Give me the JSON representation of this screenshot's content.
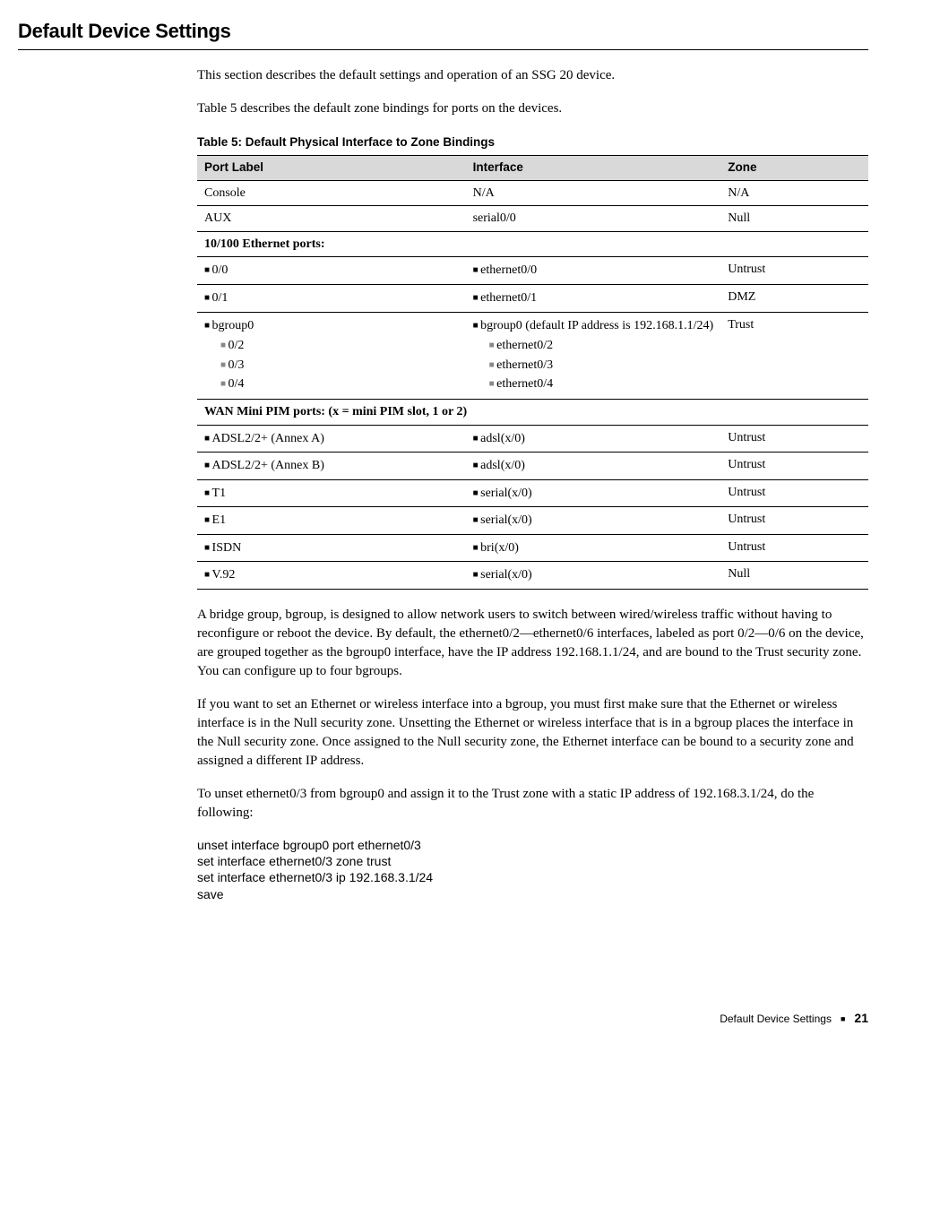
{
  "heading": "Default Device Settings",
  "intro": "This section describes the default settings and operation of an SSG 20 device.",
  "table_lead": "Table 5 describes the default zone bindings for ports on the devices.",
  "table_caption": "Table 5:  Default Physical Interface to Zone Bindings",
  "th": {
    "c1": "Port Label",
    "c2": "Interface",
    "c3": "Zone"
  },
  "rows": {
    "r0": {
      "c1": "Console",
      "c2": "N/A",
      "c3": "N/A"
    },
    "r1": {
      "c1": "AUX",
      "c2": "serial0/0",
      "c3": "Null"
    },
    "sub1": "10/100 Ethernet ports:",
    "r2": {
      "c1": "0/0",
      "c2": "ethernet0/0",
      "c3": "Untrust"
    },
    "r3": {
      "c1": "0/1",
      "c2": "ethernet0/1",
      "c3": "DMZ"
    },
    "r4": {
      "c1_main": "bgroup0",
      "c1_sub": [
        "0/2",
        "0/3",
        "0/4"
      ],
      "c2_main": "bgroup0 (default IP address is 192.168.1.1/24)",
      "c2_sub": [
        "ethernet0/2",
        "ethernet0/3",
        "ethernet0/4"
      ],
      "c3": "Trust"
    },
    "sub2": "WAN Mini PIM ports: (x = mini PIM slot, 1 or 2)",
    "r5": {
      "c1": "ADSL2/2+ (Annex A)",
      "c2": "adsl(x/0)",
      "c3": "Untrust"
    },
    "r6": {
      "c1": "ADSL2/2+ (Annex B)",
      "c2": "adsl(x/0)",
      "c3": "Untrust"
    },
    "r7": {
      "c1": "T1",
      "c2": "serial(x/0)",
      "c3": "Untrust"
    },
    "r8": {
      "c1": "E1",
      "c2": "serial(x/0)",
      "c3": "Untrust"
    },
    "r9": {
      "c1": "ISDN",
      "c2": "bri(x/0)",
      "c3": "Untrust"
    },
    "r10": {
      "c1": "V.92",
      "c2": "serial(x/0)",
      "c3": "Null"
    }
  },
  "para1": "A bridge group, bgroup, is designed to allow network users to switch between wired/wireless traffic without having to reconfigure or reboot the device. By default, the ethernet0/2—ethernet0/6 interfaces, labeled as port 0/2—0/6 on the device, are grouped together as the bgroup0 interface, have the IP address 192.168.1.1/24, and are bound to the Trust security zone. You can configure up to four bgroups.",
  "para2": "If you want to set an Ethernet or wireless interface into a bgroup, you must first make sure that the Ethernet or wireless interface is in the Null security zone. Unsetting the Ethernet or wireless interface that is in a bgroup places the interface in the Null security zone. Once assigned to the Null security zone, the Ethernet interface can be bound to a security zone and assigned a different IP address.",
  "para3": "To unset ethernet0/3 from bgroup0 and assign it to the Trust zone with a static IP address of 192.168.3.1/24, do the following:",
  "cmds": {
    "l1": "unset interface bgroup0 port ethernet0/3",
    "l2": "set interface ethernet0/3 zone trust",
    "l3": "set interface ethernet0/3 ip 192.168.3.1/24",
    "l4": "save"
  },
  "footer": {
    "title": "Default Device Settings",
    "page": "21"
  }
}
